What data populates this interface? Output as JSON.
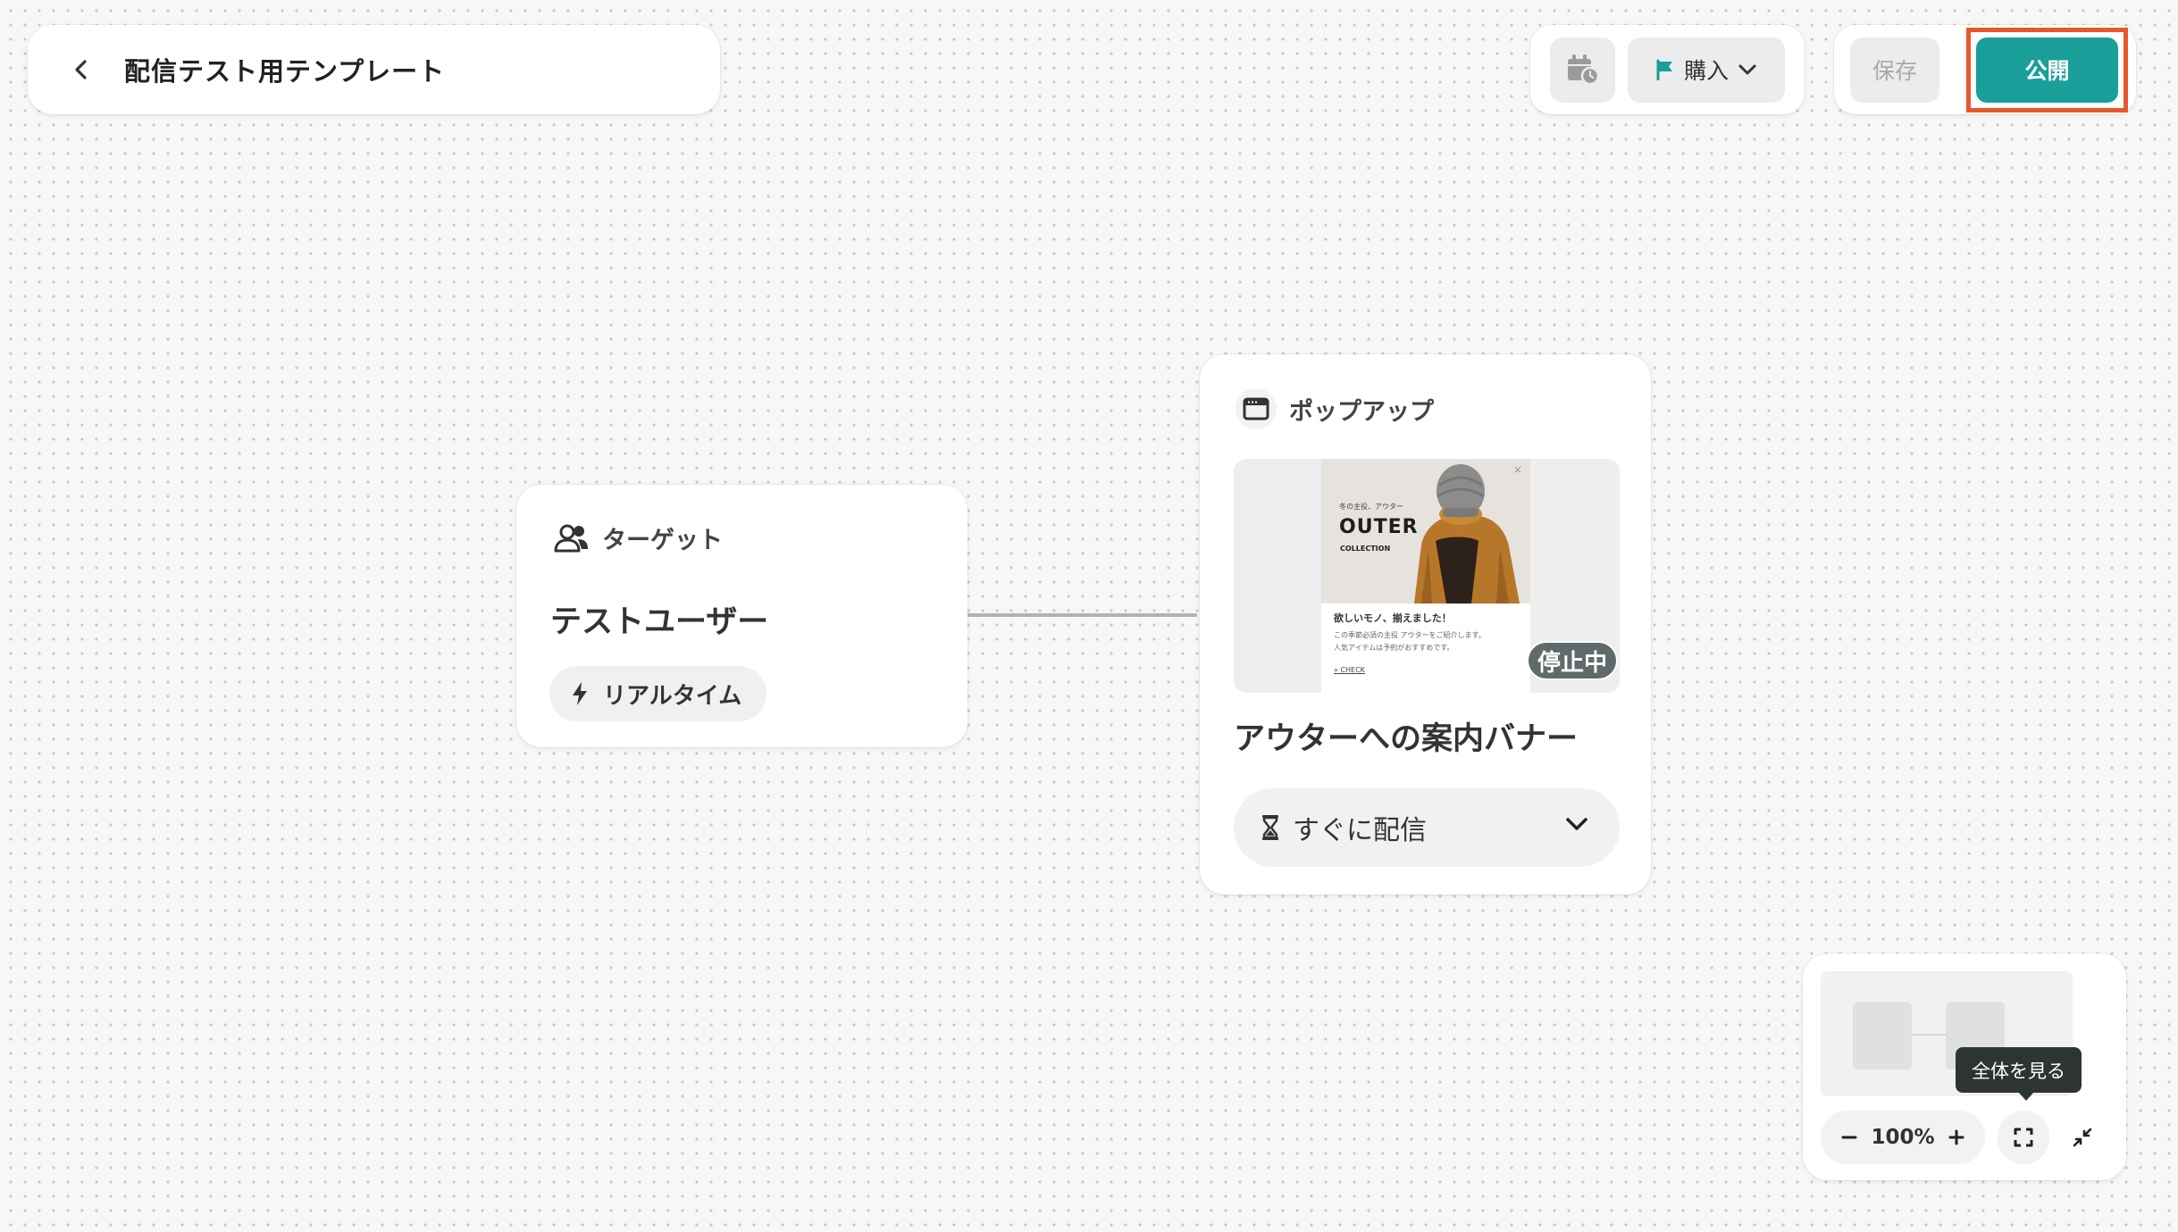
{
  "header": {
    "title": "配信テスト用テンプレート",
    "goal_label": "購入",
    "save_label": "保存",
    "publish_label": "公開"
  },
  "target_node": {
    "heading": "ターゲット",
    "name": "テストユーザー",
    "trigger_label": "リアルタイム"
  },
  "popup_node": {
    "heading": "ポップアップ",
    "preview": {
      "eyebrow": "冬の主役、アウター",
      "brand": "OUTER",
      "brand_sub": "COLLECTION",
      "headline": "欲しいモノ、揃えました！",
      "body_line1": "この季節必須の主役 アウターをご紹介します。",
      "body_line2": "人気アイテムは予約がおすすめです。",
      "link": "» CHECK"
    },
    "status_badge": "停止中",
    "name": "アウターへの案内バナー",
    "schedule_label": "すぐに配信"
  },
  "minimap": {
    "tooltip": "全体を見る",
    "zoom_level": "100%"
  },
  "colors": {
    "accent": "#1a9e9a",
    "highlight_border": "#e8572c",
    "status_badge": "#5f6a6a"
  }
}
